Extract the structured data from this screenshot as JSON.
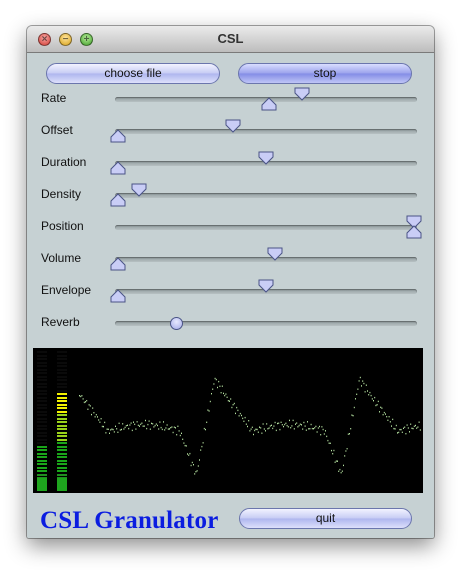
{
  "window": {
    "title": "CSL"
  },
  "buttons": {
    "choose_file": "choose file",
    "stop": "stop",
    "quit": "quit"
  },
  "sliders": [
    {
      "label": "Rate",
      "value": 0.62,
      "thumb": "down-and-up"
    },
    {
      "label": "Offset",
      "value": 0.0,
      "thumb": "up-and-down"
    },
    {
      "label": "Duration",
      "value": 0.0,
      "thumb": "up-and-down"
    },
    {
      "label": "Density",
      "value": 0.0,
      "thumb": "up-and-down"
    },
    {
      "label": "Position",
      "value": 1.0,
      "thumb": "both"
    },
    {
      "label": "Volume",
      "value": 0.0,
      "thumb": "up-and-down"
    },
    {
      "label": "Envelope",
      "value": 0.0,
      "thumb": "up-and-down"
    },
    {
      "label": "Reverb",
      "value": 0.2,
      "thumb": "round"
    }
  ],
  "secondary_thumbs": [
    0.51,
    0.39,
    0.5,
    0.07,
    1.0,
    0.53,
    0.5
  ],
  "meters": [
    {
      "level": 0.33
    },
    {
      "level": 0.7
    }
  ],
  "brand": "CSL Granulator",
  "colors": {
    "brand_text": "#0b1de0",
    "window_bg": "#c6d1d3",
    "meter_low": "#1aa51a",
    "meter_high": "#f2f200",
    "wave": "#b9e6a4"
  }
}
